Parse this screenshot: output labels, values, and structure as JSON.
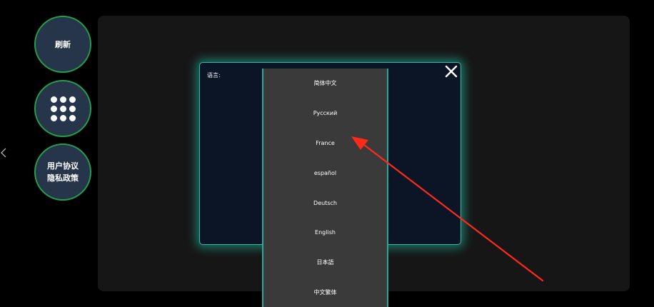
{
  "sidebar": {
    "refresh_label": "刷新",
    "grid_icon": "grid-dots-icon",
    "policy_line1": "用户协议",
    "policy_line2": "隐私政策"
  },
  "dialog": {
    "label": "语言:",
    "close_icon": "close-icon"
  },
  "languages": [
    "简体中文",
    "Русский",
    "France",
    "español",
    "Deutsch",
    "English",
    "日本語",
    "中文繁体"
  ],
  "colors": {
    "button_bg": "#263549",
    "button_border": "#22a04a",
    "dialog_bg": "#0b1526",
    "dialog_glow": "#2fb9a6",
    "dropdown_bg": "#3a3a3a",
    "annotation_arrow": "#ff2a1a"
  }
}
